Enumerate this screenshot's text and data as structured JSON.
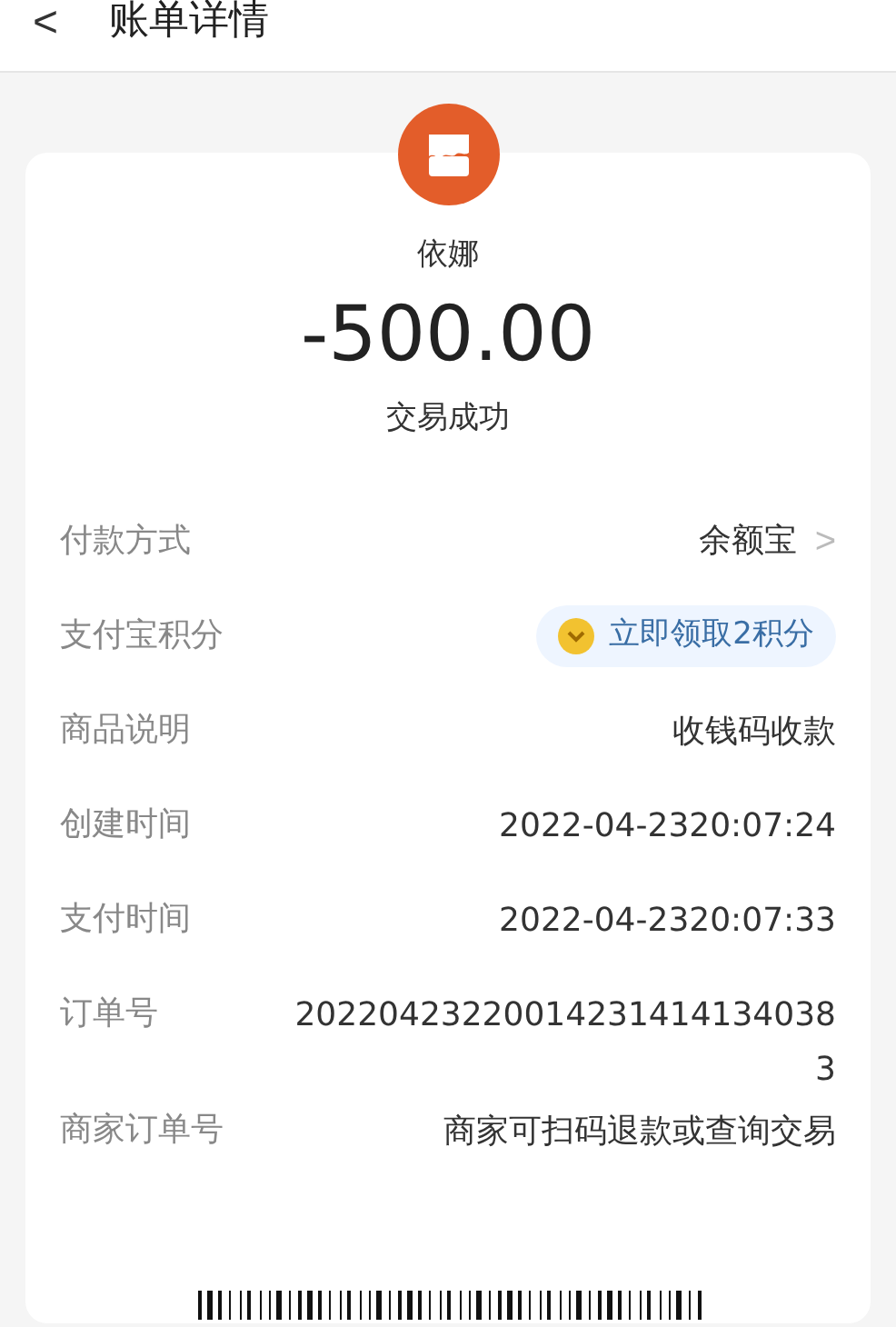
{
  "header": {
    "back": "<",
    "title": "账单详情"
  },
  "merchant": {
    "name": "依娜",
    "amount": "-500.00",
    "status": "交易成功"
  },
  "rows": [
    {
      "kind": "link",
      "label": "付款方式",
      "value": "余额宝",
      "chevron": ">"
    },
    {
      "kind": "badge",
      "label": "支付宝积分",
      "value": "立即领取2积分"
    },
    {
      "kind": "text",
      "label": "商品说明",
      "value": "收钱码收款"
    },
    {
      "kind": "text",
      "label": "创建时间",
      "value": "2022-04-2320:07:24"
    },
    {
      "kind": "text",
      "label": "支付时间",
      "value": "2022-04-2320:07:33"
    },
    {
      "kind": "text",
      "label": "订单号",
      "value": "20220423220014231414134038 3"
    },
    {
      "kind": "text",
      "label": "商家订单号",
      "value": "商家可扫码退款或查询交易"
    }
  ]
}
